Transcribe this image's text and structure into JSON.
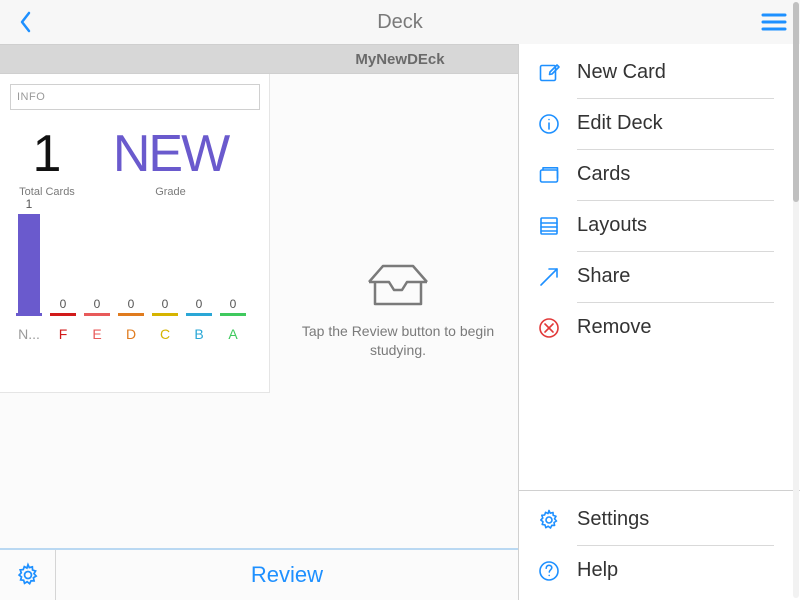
{
  "nav": {
    "title": "Deck"
  },
  "deck": {
    "name": "MyNewDEck"
  },
  "info": {
    "label": "INFO"
  },
  "stats": {
    "total": {
      "value": "1",
      "label": "Total Cards"
    },
    "grade": {
      "value": "NEW",
      "label": "Grade"
    }
  },
  "chart_data": {
    "type": "bar",
    "categories": [
      "N...",
      "F",
      "E",
      "D",
      "C",
      "B",
      "A"
    ],
    "values": [
      1,
      0,
      0,
      0,
      0,
      0,
      0
    ],
    "bar_colors": [
      "#6a5acd",
      "#d11a1a",
      "#e85a5a",
      "#e07b1e",
      "#d6b400",
      "#2aa7d6",
      "#3fc95e"
    ],
    "label_colors": [
      "#9a9a9a",
      "#d11a1a",
      "#e85a5a",
      "#e07b1e",
      "#d6b400",
      "#2aa7d6",
      "#3fc95e"
    ],
    "ylim": [
      0,
      1
    ]
  },
  "center": {
    "hint": "Tap the Review button to begin studying."
  },
  "toolbar": {
    "review": "Review"
  },
  "menu": {
    "primary": [
      {
        "icon": "compose-icon",
        "label": "New Card",
        "color": "#1e90ff"
      },
      {
        "icon": "info-icon",
        "label": "Edit Deck",
        "color": "#1e90ff"
      },
      {
        "icon": "cards-icon",
        "label": "Cards",
        "color": "#1e90ff"
      },
      {
        "icon": "layouts-icon",
        "label": "Layouts",
        "color": "#1e90ff"
      },
      {
        "icon": "share-icon",
        "label": "Share",
        "color": "#1e90ff"
      },
      {
        "icon": "remove-icon",
        "label": "Remove",
        "color": "#e23a3a"
      }
    ],
    "secondary": [
      {
        "icon": "settings-icon",
        "label": "Settings",
        "color": "#1e90ff"
      },
      {
        "icon": "help-icon",
        "label": "Help",
        "color": "#1e90ff"
      }
    ]
  }
}
